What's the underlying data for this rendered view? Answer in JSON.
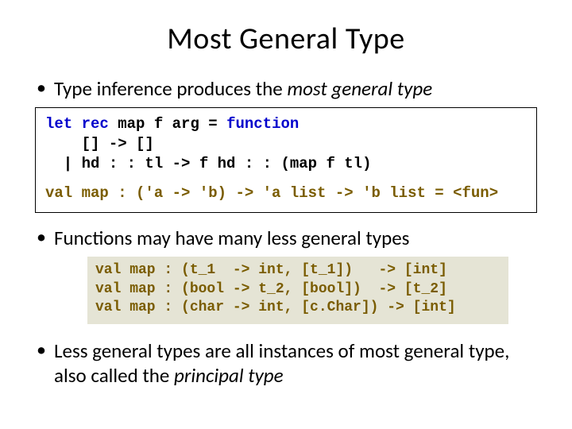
{
  "title": "Most General Type",
  "bullet1_prefix": "Type inference produces the ",
  "bullet1_em": "most general type",
  "code1": {
    "l1a": "let rec",
    "l1b": " map f arg = ",
    "l1c": "function",
    "l2": "    [] -> []",
    "l3": "  | hd : : tl -> f hd : : (map f tl)",
    "sig": "val map : ('a -> 'b) -> 'a list -> 'b list = <fun>"
  },
  "bullet2": "Functions may have many less general types",
  "code2": {
    "l1": "val map : (t_1  -> int, [t_1])   -> [int]",
    "l2": "val map : (bool -> t_2, [bool])  -> [t_2]",
    "l3": "val map : (char -> int, [c.Char]) -> [int]"
  },
  "bullet3_prefix": "Less general types are all instances of most general type, also called the ",
  "bullet3_em": "principal type"
}
